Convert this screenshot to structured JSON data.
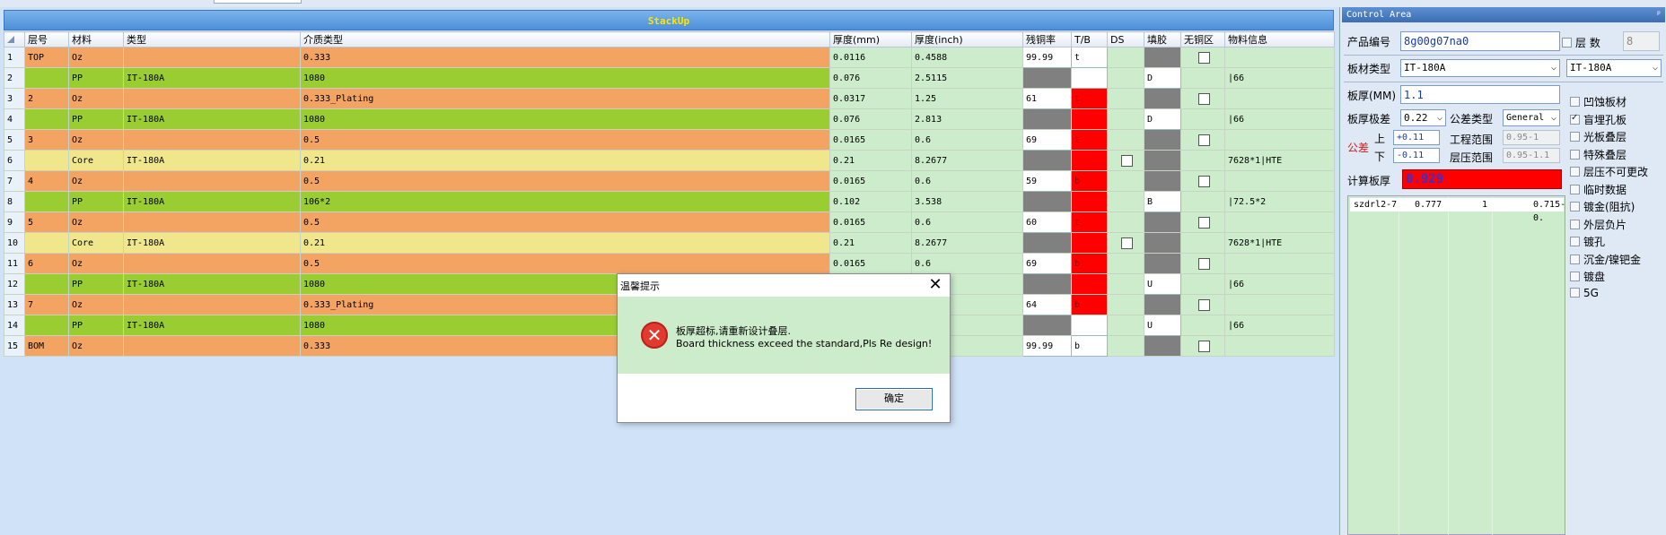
{
  "stackup": {
    "title": "StackUp",
    "columns": [
      "层号",
      "材料",
      "类型",
      "介质类型",
      "厚度(mm)",
      "厚度(inch)",
      "残铜率",
      "T/B",
      "DS",
      "填胶",
      "无铜区",
      "物料信息"
    ],
    "rows": [
      {
        "no": "1",
        "layer": "TOP",
        "material": "Oz",
        "type": "",
        "dielectric": "0.333",
        "mm": "0.0116",
        "inch": "0.4588",
        "residual": "99.99",
        "tb": "t",
        "info": "",
        "style": "orange",
        "residual_cell": "white",
        "tb_cell": "white",
        "fill_cell": "gray",
        "ds_cb": false,
        "nocu_cb": true
      },
      {
        "no": "2",
        "layer": "",
        "material": "PP",
        "type": "IT-180A",
        "dielectric": "1080",
        "mm": "0.076",
        "inch": "2.5115",
        "residual": "",
        "tb": "",
        "info": "|66",
        "style": "green",
        "residual_cell": "gray",
        "tb_cell": "white",
        "fill_cell": "white",
        "fill_text": "D",
        "ds_cb": false,
        "nocu_cb": false
      },
      {
        "no": "3",
        "layer": "2",
        "material": "Oz",
        "type": "",
        "dielectric": "0.333_Plating",
        "mm": "0.0317",
        "inch": "1.25",
        "residual": "61",
        "tb": "t",
        "info": "",
        "style": "orange",
        "residual_cell": "white",
        "tb_cell": "red",
        "fill_cell": "gray",
        "ds_cb": false,
        "nocu_cb": true
      },
      {
        "no": "4",
        "layer": "",
        "material": "PP",
        "type": "IT-180A",
        "dielectric": "1080",
        "mm": "0.076",
        "inch": "2.813",
        "residual": "",
        "tb": "",
        "info": "|66",
        "style": "green",
        "residual_cell": "gray",
        "tb_cell": "red",
        "fill_cell": "white",
        "fill_text": "D",
        "ds_cb": false,
        "nocu_cb": false
      },
      {
        "no": "5",
        "layer": "3",
        "material": "Oz",
        "type": "",
        "dielectric": "0.5",
        "mm": "0.0165",
        "inch": "0.6",
        "residual": "69",
        "tb": "t",
        "info": "",
        "style": "orange",
        "residual_cell": "white",
        "tb_cell": "red",
        "fill_cell": "gray",
        "ds_cb": false,
        "nocu_cb": true
      },
      {
        "no": "6",
        "layer": "",
        "material": "Core",
        "type": "IT-180A",
        "dielectric": "0.21",
        "mm": "0.21",
        "inch": "8.2677",
        "residual": "",
        "tb": "",
        "info": "7628*1|HTE",
        "style": "yellow",
        "residual_cell": "gray",
        "tb_cell": "red",
        "fill_cell": "gray",
        "ds_cb": true,
        "nocu_cb": false
      },
      {
        "no": "7",
        "layer": "4",
        "material": "Oz",
        "type": "",
        "dielectric": "0.5",
        "mm": "0.0165",
        "inch": "0.6",
        "residual": "59",
        "tb": "b",
        "info": "",
        "style": "orange",
        "residual_cell": "white",
        "tb_cell": "red",
        "fill_cell": "gray",
        "ds_cb": false,
        "nocu_cb": true
      },
      {
        "no": "8",
        "layer": "",
        "material": "PP",
        "type": "IT-180A",
        "dielectric": "106*2",
        "mm": "0.102",
        "inch": "3.538",
        "residual": "",
        "tb": "",
        "info": "|72.5*2",
        "style": "green",
        "residual_cell": "gray",
        "tb_cell": "red",
        "fill_cell": "white",
        "fill_text": "B",
        "ds_cb": false,
        "nocu_cb": false
      },
      {
        "no": "9",
        "layer": "5",
        "material": "Oz",
        "type": "",
        "dielectric": "0.5",
        "mm": "0.0165",
        "inch": "0.6",
        "residual": "60",
        "tb": "t",
        "info": "",
        "style": "orange",
        "residual_cell": "white",
        "tb_cell": "red",
        "fill_cell": "gray",
        "ds_cb": false,
        "nocu_cb": true
      },
      {
        "no": "10",
        "layer": "",
        "material": "Core",
        "type": "IT-180A",
        "dielectric": "0.21",
        "mm": "0.21",
        "inch": "8.2677",
        "residual": "",
        "tb": "",
        "info": "7628*1|HTE",
        "style": "yellow",
        "residual_cell": "gray",
        "tb_cell": "red",
        "fill_cell": "gray",
        "ds_cb": true,
        "nocu_cb": false
      },
      {
        "no": "11",
        "layer": "6",
        "material": "Oz",
        "type": "",
        "dielectric": "0.5",
        "mm": "0.0165",
        "inch": "0.6",
        "residual": "69",
        "tb": "b",
        "info": "",
        "style": "orange",
        "residual_cell": "white",
        "tb_cell": "red",
        "fill_cell": "gray",
        "ds_cb": false,
        "nocu_cb": true
      },
      {
        "no": "12",
        "layer": "",
        "material": "PP",
        "type": "IT-180A",
        "dielectric": "1080",
        "mm": "",
        "inch": "",
        "residual": "",
        "tb": "",
        "info": "|66",
        "style": "green",
        "residual_cell": "gray",
        "tb_cell": "red",
        "fill_cell": "white",
        "fill_text": "U",
        "ds_cb": false,
        "nocu_cb": false
      },
      {
        "no": "13",
        "layer": "7",
        "material": "Oz",
        "type": "",
        "dielectric": "0.333_Plating",
        "mm": "",
        "inch": "",
        "residual": "64",
        "tb": "b",
        "info": "",
        "style": "orange",
        "residual_cell": "white",
        "tb_cell": "red",
        "fill_cell": "gray",
        "ds_cb": false,
        "nocu_cb": true
      },
      {
        "no": "14",
        "layer": "",
        "material": "PP",
        "type": "IT-180A",
        "dielectric": "1080",
        "mm": "",
        "inch": "",
        "residual": "",
        "tb": "",
        "info": "|66",
        "style": "green",
        "residual_cell": "gray",
        "tb_cell": "white",
        "fill_cell": "white",
        "fill_text": "U",
        "ds_cb": false,
        "nocu_cb": false
      },
      {
        "no": "15",
        "layer": "BOM",
        "material": "Oz",
        "type": "",
        "dielectric": "0.333",
        "mm": "",
        "inch": "",
        "residual": "99.99",
        "tb": "b",
        "info": "",
        "style": "orange",
        "residual_cell": "white",
        "tb_cell": "white",
        "fill_cell": "gray",
        "ds_cb": false,
        "nocu_cb": true
      }
    ]
  },
  "dialog": {
    "title": "温馨提示",
    "message_cn": "板厚超标,请重新设计叠层.",
    "message_en": "Board thickness exceed the standard,Pls Re design!",
    "ok_label": "确定",
    "close_glyph": "✕",
    "icon_glyph": "✕"
  },
  "control": {
    "header": "Control Area",
    "pin_glyph": "ᵖ",
    "product_label": "产品编号",
    "product_value": "8g00g07na0",
    "layers_label": "层 数",
    "layers_value": "8",
    "board_type_label": "板材类型",
    "board_type_value": "IT-180A",
    "board_type_value2": "IT-180A",
    "thickness_label": "板厚(MM)",
    "thickness_value": "1.1",
    "tolerance_label": "板厚极差",
    "tolerance_value": "0.22",
    "tol_type_label": "公差类型",
    "tol_type_value": "General",
    "tol_label": "公差",
    "upper_label": "上",
    "lower_label": "下",
    "upper_value": "+0.11",
    "lower_value": "-0.11",
    "eng_range_label": "工程范围",
    "eng_range_value": "0.95-1",
    "press_range_label": "层压范围",
    "press_range_value": "0.95-1.1",
    "calc_label": "计算板厚",
    "calc_value": "0.929",
    "list_row": {
      "a": "szdrl2-7",
      "b": "0.777",
      "c": "1",
      "d": "0.715-0."
    },
    "options": [
      {
        "label": "凹蚀板材",
        "checked": false
      },
      {
        "label": "盲埋孔板",
        "checked": true
      },
      {
        "label": "光板叠层",
        "checked": false
      },
      {
        "label": "特殊叠层",
        "checked": false
      },
      {
        "label": "层压不可更改",
        "checked": false
      },
      {
        "label": "临时数据",
        "checked": false
      },
      {
        "label": "镀金(阻抗)",
        "checked": false
      },
      {
        "label": "外层负片",
        "checked": false
      },
      {
        "label": "镀孔",
        "checked": false
      },
      {
        "label": "沉金/镍钯金",
        "checked": false
      },
      {
        "label": "镀盘",
        "checked": false
      },
      {
        "label": "5G",
        "checked": false
      }
    ]
  }
}
